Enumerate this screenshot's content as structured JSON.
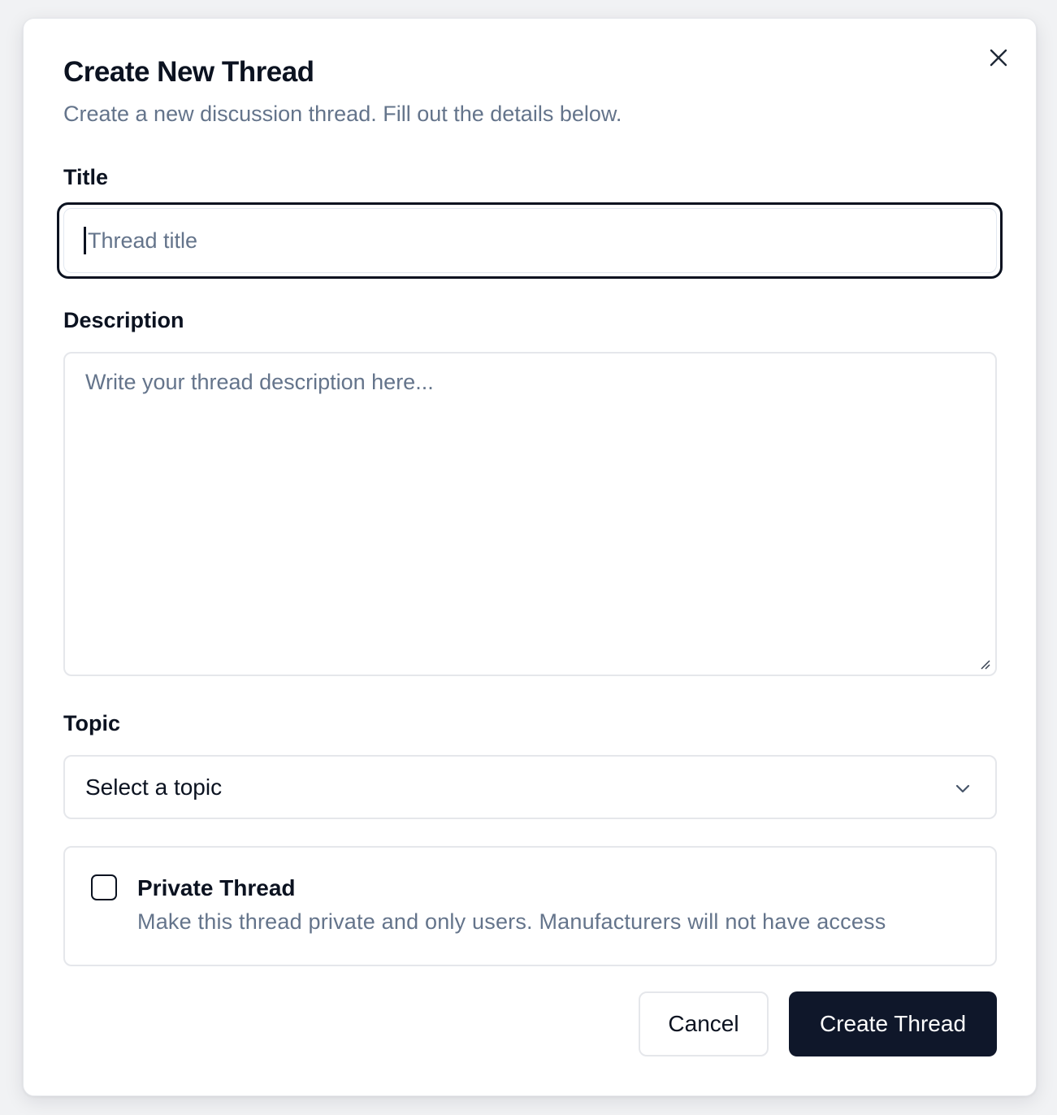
{
  "dialog": {
    "title": "Create New Thread",
    "subtitle": "Create a new discussion thread. Fill out the details below."
  },
  "fields": {
    "title_label": "Title",
    "title_placeholder": "Thread title",
    "description_label": "Description",
    "description_placeholder": "Write your thread description here...",
    "topic_label": "Topic",
    "topic_selected": "Select a topic"
  },
  "private_option": {
    "label": "Private Thread",
    "description": "Make this thread private and only users. Manufacturers will not have access",
    "checked": false
  },
  "actions": {
    "cancel_label": "Cancel",
    "create_label": "Create Thread"
  },
  "icons": {
    "close": "close-icon",
    "chevron": "chevron-down-icon",
    "resize": "resize-handle-icon"
  },
  "colors": {
    "primary": "#0f172a",
    "muted_text": "#64748b",
    "border": "#e5e7eb"
  }
}
